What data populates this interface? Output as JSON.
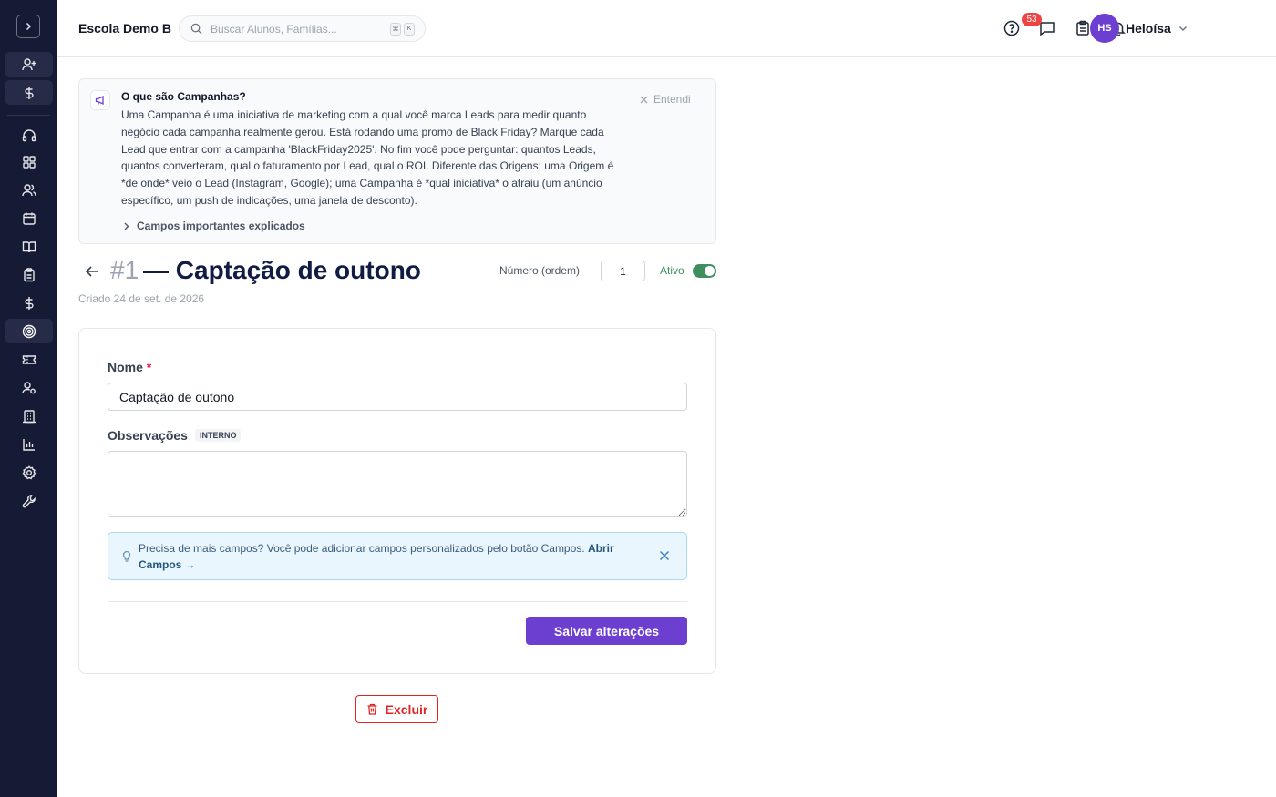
{
  "topbar": {
    "school_name": "Escola Demo B",
    "search_placeholder": "Buscar Alunos, Famílias...",
    "shortcut_keys": [
      "⌘",
      "K"
    ],
    "notifications_count": "53",
    "user_initials": "HS",
    "user_name": "Heloísa"
  },
  "sidebar": {
    "items": [
      "add-user-icon",
      "dollar-icon",
      "headset-icon",
      "dashboard-icon",
      "users-icon",
      "calendar-icon",
      "book-icon",
      "clipboard-icon",
      "dollar-icon",
      "target-icon",
      "ticket-icon",
      "user-settings-icon",
      "building-icon",
      "bar-chart-icon",
      "gear-icon",
      "wrench-icon"
    ],
    "active_item": "target-icon"
  },
  "info": {
    "title": "O que são Campanhas?",
    "text": "Uma Campanha é uma iniciativa de marketing com a qual você marca Leads para medir quanto negócio cada campanha realmente gerou. Está rodando uma promo de Black Friday? Marque cada Lead que entrar com a campanha 'BlackFriday2025'. No fim você pode perguntar: quantos Leads, quantos converteram, qual o faturamento por Lead, qual o ROI. Diferente das Origens: uma Origem é *de onde* veio o Lead (Instagram, Google); uma Campanha é *qual iniciativa* o atraiu (um anúncio específico, um push de indicações, uma janela de desconto).",
    "dismiss_label": "Entendi",
    "more_label": "Campos importantes explicados"
  },
  "header": {
    "number": "#1",
    "title": "— Captação de outono",
    "created": "Criado 24 de set. de 2026",
    "order_label": "Número (ordem)",
    "order_value": "1",
    "active_label": "Ativo",
    "active": true
  },
  "form": {
    "name_label": "Nome",
    "required_mark": "*",
    "name_value": "Captação de outono",
    "obs_label": "Observações",
    "obs_tag": "INTERNO",
    "obs_value": "",
    "tip_text": "Precisa de mais campos? Você pode adicionar campos personalizados pelo botão Campos.",
    "tip_link": "Abrir Campos →",
    "save_label": "Salvar alterações"
  },
  "delete_label": "Excluir",
  "colors": {
    "sidebar_bg": "#151a35",
    "accent": "#6d3fd0",
    "active_green": "#3f8f5e",
    "danger": "#dc2626"
  }
}
